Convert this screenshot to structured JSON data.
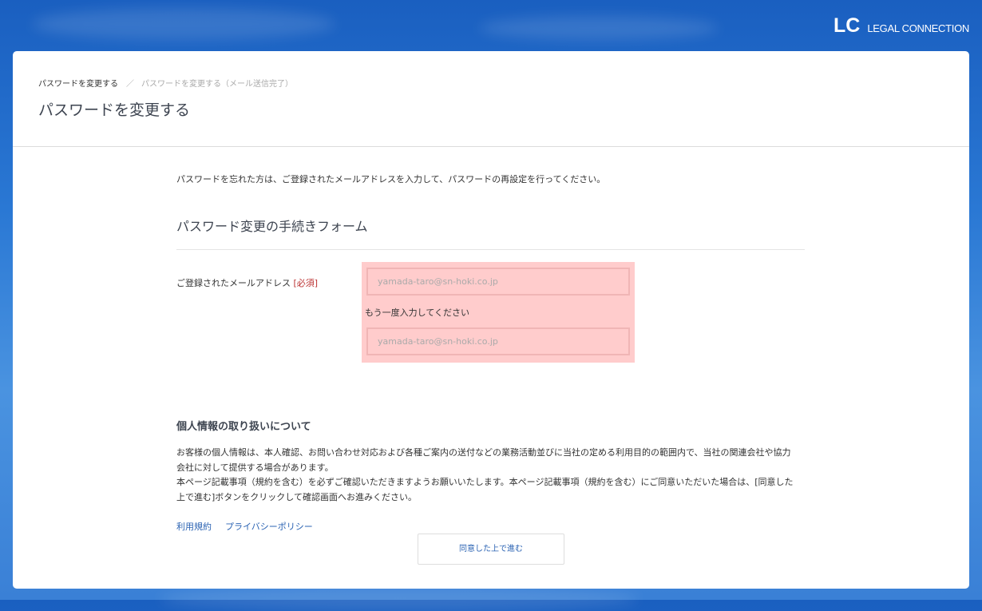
{
  "logo": {
    "mark": "LC",
    "text": "LEGAL CONNECTION"
  },
  "breadcrumb": {
    "items": [
      "パスワードを変更する",
      "パスワードを変更する（メール送信完了）"
    ],
    "separator": "／"
  },
  "page_title": "パスワードを変更する",
  "intro": "パスワードを忘れた方は、ご登録されたメールアドレスを入力して、パスワードの再設定を行ってください。",
  "form": {
    "title": "パスワード変更の手続きフォーム",
    "email_label": "ご登録されたメールアドレス",
    "required": "[必須]",
    "email_placeholder": "yamada-taro@sn-hoki.co.jp",
    "confirm_label": "もう一度入力してください",
    "confirm_placeholder": "yamada-taro@sn-hoki.co.jp"
  },
  "privacy": {
    "title": "個人情報の取り扱いについて",
    "lines": [
      "お客様の個人情報は、本人確認、お問い合わせ対応および各種ご案内の送付などの業務活動並びに当社の定める利用目的の範囲内で、当社の関連会社や協力",
      "会社に対して提供する場合があります。",
      "本ページ記載事項（規約を含む）を必ずご確認いただきますようお願いいたします。本ページ記載事項（規約を含む）にご同意いただいた場合は、[同意した",
      "上で進む]ボタンをクリックして確認画面へお進みください。"
    ]
  },
  "links": {
    "terms": "利用規約",
    "privacy_policy": "プライバシーポリシー"
  },
  "agree_button": "同意した上で進む",
  "colors": {
    "accent": "#2b63b3",
    "error_bg": "#ffcccc",
    "required": "#b33333"
  }
}
